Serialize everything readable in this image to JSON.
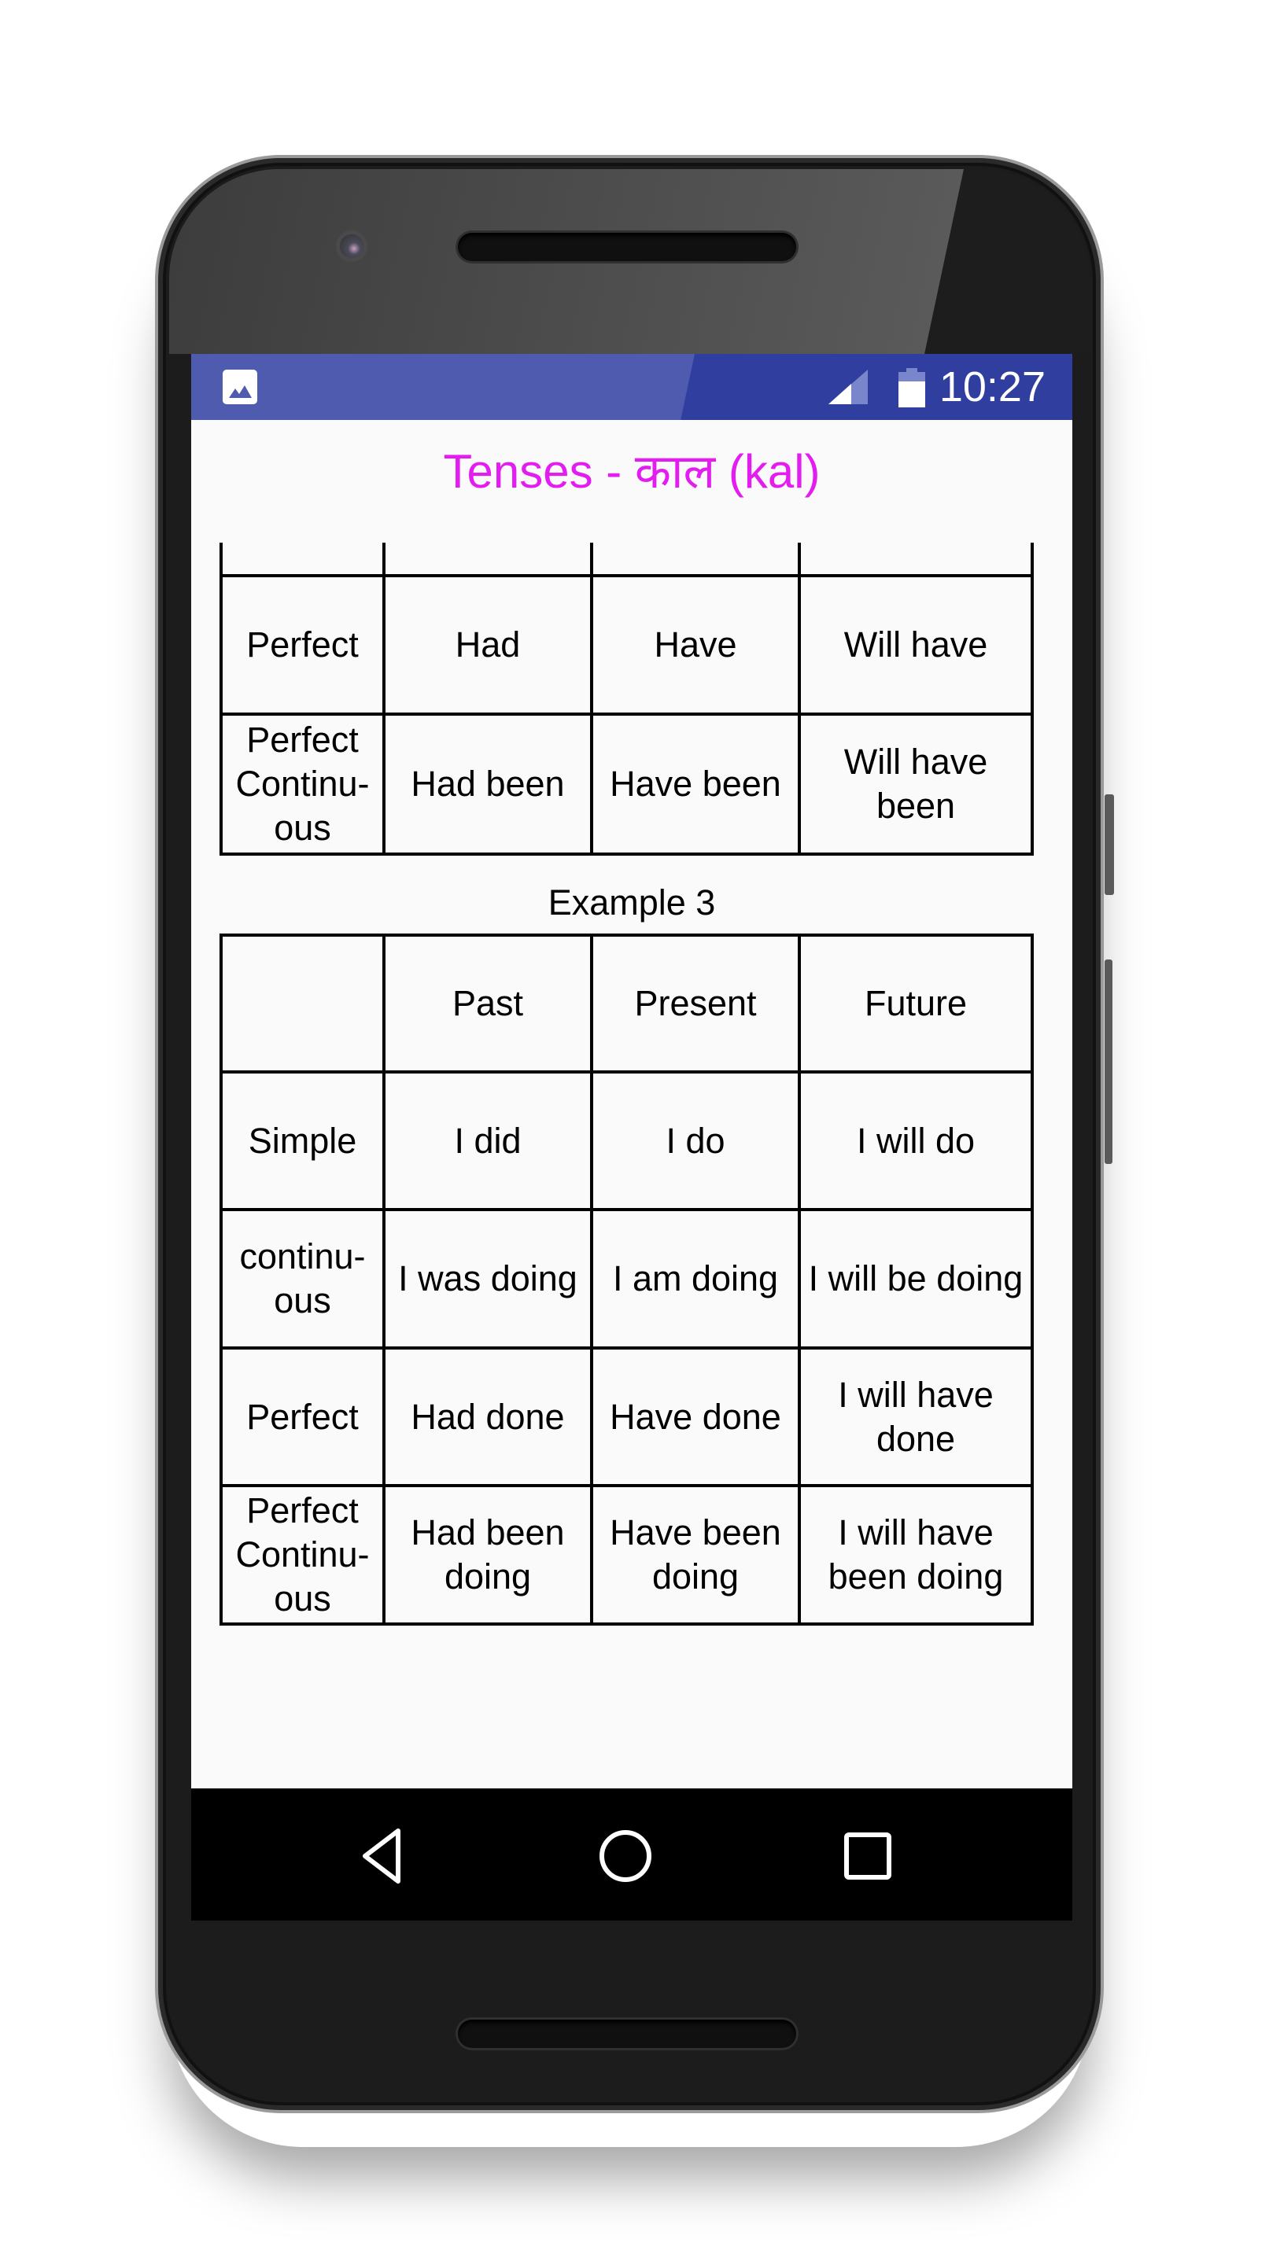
{
  "status_bar": {
    "left_icon": "image-notification-icon",
    "right_icons": [
      "signal-icon",
      "battery-icon"
    ],
    "time": "10:27",
    "color": "#303F9F"
  },
  "app": {
    "title": "Tenses -  काल (kal)",
    "title_color": "#E31CF0"
  },
  "table_partial": {
    "rows": [
      {
        "label": "",
        "past": "",
        "present": "",
        "future": ""
      },
      {
        "label": "Perfect",
        "past": "Had",
        "present": "Have",
        "future": "Will have"
      },
      {
        "label": "Perfect Continu-ous",
        "past": "Had been",
        "present": "Have been",
        "future": "Will have been"
      }
    ]
  },
  "example3": {
    "caption": "Example 3",
    "header": {
      "label": "",
      "past": "Past",
      "present": "Present",
      "future": "Future"
    },
    "rows": [
      {
        "label": "Simple",
        "past": "I did",
        "present": "I do",
        "future": "I will do"
      },
      {
        "label": "continu-ous",
        "past": "I was doing",
        "present": "I am doing",
        "future": "I will be doing"
      },
      {
        "label": "Perfect",
        "past": "Had done",
        "present": "Have done",
        "future": "I will have done"
      },
      {
        "label": "Perfect Continu-ous",
        "past": "Had been doing",
        "present": "Have been doing",
        "future": "I will have been doing"
      }
    ]
  },
  "nav_bar": {
    "buttons": [
      "back-icon",
      "home-icon",
      "recents-icon"
    ]
  }
}
